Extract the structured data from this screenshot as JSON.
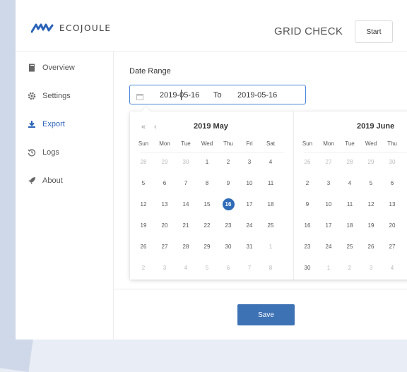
{
  "header": {
    "logo_text": "ECOJOULE",
    "title": "GRID CHECK",
    "start_label": "Start"
  },
  "sidebar": {
    "items": [
      {
        "label": "Overview",
        "icon": "file-icon"
      },
      {
        "label": "Settings",
        "icon": "gear-icon"
      },
      {
        "label": "Export",
        "icon": "download-icon"
      },
      {
        "label": "Logs",
        "icon": "history-icon"
      },
      {
        "label": "About",
        "icon": "rocket-icon"
      }
    ]
  },
  "form": {
    "date_range_label": "Date Range",
    "start_date": "2019-05-16",
    "separator": "To",
    "end_date": "2019-05-16",
    "save_label": "Save"
  },
  "calendar": {
    "weekdays": [
      "Sun",
      "Mon",
      "Tue",
      "Wed",
      "Thu",
      "Fri",
      "Sat"
    ],
    "left": {
      "title": "2019 May",
      "prev_year": "«",
      "prev_month": "‹",
      "selected": "16",
      "weeks": [
        [
          "28",
          "29",
          "30",
          "1",
          "2",
          "3",
          "4"
        ],
        [
          "5",
          "6",
          "7",
          "8",
          "9",
          "10",
          "11"
        ],
        [
          "12",
          "13",
          "14",
          "15",
          "16",
          "17",
          "18"
        ],
        [
          "19",
          "20",
          "21",
          "22",
          "23",
          "24",
          "25"
        ],
        [
          "26",
          "27",
          "28",
          "29",
          "30",
          "31",
          "1"
        ],
        [
          "2",
          "3",
          "4",
          "5",
          "6",
          "7",
          "8"
        ]
      ],
      "muted": [
        [
          1,
          1,
          1,
          0,
          0,
          0,
          0
        ],
        [
          0,
          0,
          0,
          0,
          0,
          0,
          0
        ],
        [
          0,
          0,
          0,
          0,
          0,
          0,
          0
        ],
        [
          0,
          0,
          0,
          0,
          0,
          0,
          0
        ],
        [
          0,
          0,
          0,
          0,
          0,
          0,
          1
        ],
        [
          1,
          1,
          1,
          1,
          1,
          1,
          1
        ]
      ]
    },
    "right": {
      "title": "2019 June",
      "weeks": [
        [
          "26",
          "27",
          "28",
          "29",
          "30"
        ],
        [
          "2",
          "3",
          "4",
          "5",
          "6"
        ],
        [
          "9",
          "10",
          "11",
          "12",
          "13"
        ],
        [
          "16",
          "17",
          "18",
          "19",
          "20"
        ],
        [
          "23",
          "24",
          "25",
          "26",
          "27"
        ],
        [
          "30",
          "1",
          "2",
          "3",
          "4"
        ]
      ],
      "muted": [
        [
          1,
          1,
          1,
          1,
          1
        ],
        [
          0,
          0,
          0,
          0,
          0
        ],
        [
          0,
          0,
          0,
          0,
          0
        ],
        [
          0,
          0,
          0,
          0,
          0
        ],
        [
          0,
          0,
          0,
          0,
          0
        ],
        [
          0,
          1,
          1,
          1,
          1
        ]
      ]
    }
  },
  "colors": {
    "accent": "#2f6bb6",
    "button": "#3d72b5"
  }
}
